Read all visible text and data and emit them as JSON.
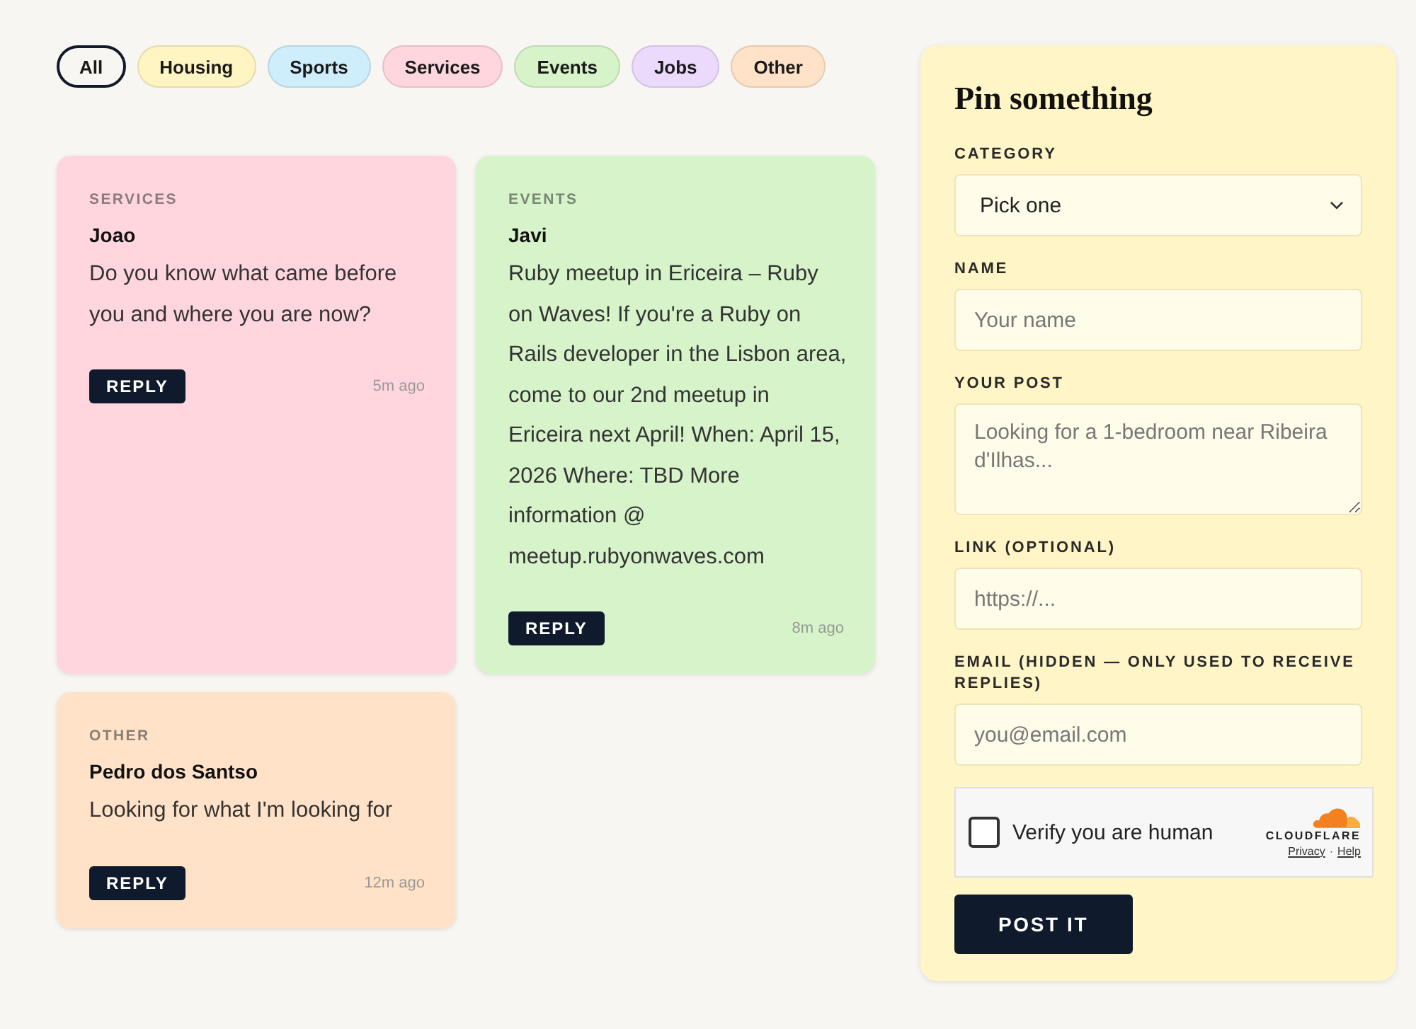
{
  "filters": [
    {
      "label": "All",
      "selected": true
    },
    {
      "label": "Housing",
      "selected": false,
      "color": "#fff5c2"
    },
    {
      "label": "Sports",
      "selected": false,
      "color": "#cfeefc"
    },
    {
      "label": "Services",
      "selected": false,
      "color": "#ffd6de"
    },
    {
      "label": "Events",
      "selected": false,
      "color": "#d6f3c9"
    },
    {
      "label": "Jobs",
      "selected": false,
      "color": "#ebdafc"
    },
    {
      "label": "Other",
      "selected": false,
      "color": "#ffe2c7"
    }
  ],
  "posts": [
    {
      "category": "SERVICES",
      "author": "Joao",
      "body": "Do you know what came before you and where you are now?",
      "reply": "REPLY",
      "time": "5m ago",
      "color": "#ffd6de"
    },
    {
      "category": "EVENTS",
      "author": "Javi",
      "body": "Ruby meetup in Ericeira – Ruby on Waves! If you're a Ruby on Rails developer in the Lisbon area, come to our 2nd meetup in Ericeira next April! When: April 15, 2026 Where: TBD More information @ meetup.rubyonwaves.com",
      "reply": "REPLY",
      "time": "8m ago",
      "color": "#d6f3c9"
    },
    {
      "category": "OTHER",
      "author": "Pedro dos Santso",
      "body": "Looking for what I'm looking for",
      "reply": "REPLY",
      "time": "12m ago",
      "color": "#ffe2c7"
    }
  ],
  "form": {
    "title": "Pin something",
    "fields": [
      {
        "kind": "select",
        "label": "CATEGORY",
        "value": "Pick one"
      },
      {
        "kind": "text",
        "label": "NAME",
        "placeholder": "Your name"
      },
      {
        "kind": "textarea",
        "label": "YOUR POST",
        "placeholder": "Looking for a 1-bedroom near Ribeira d'Ilhas..."
      },
      {
        "kind": "text",
        "label": "LINK (OPTIONAL)",
        "placeholder": "https://..."
      },
      {
        "kind": "text",
        "label": "EMAIL (HIDDEN — ONLY USED TO RECEIVE REPLIES)",
        "placeholder": "you@email.com"
      }
    ],
    "captcha": {
      "label": "Verify you are human",
      "checked": false,
      "brand": "CLOUDFLARE",
      "links": [
        "Privacy",
        "Help"
      ],
      "separator": "·"
    },
    "submit": "POST IT"
  }
}
